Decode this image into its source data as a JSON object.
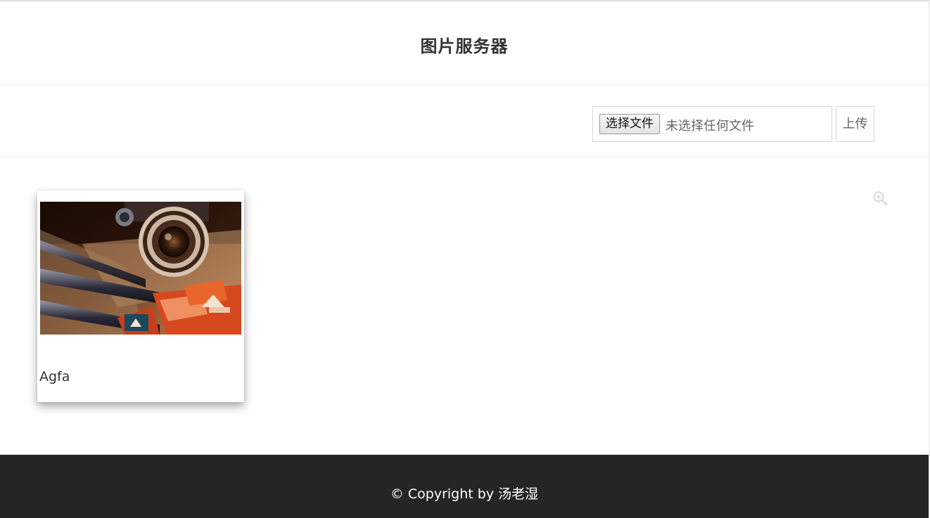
{
  "header": {
    "title": "图片服务器"
  },
  "upload": {
    "choose_file_label": "选择文件",
    "no_file_text": "未选择任何文件",
    "upload_label": "上传"
  },
  "gallery": {
    "zoom_icon": "zoom-in-icon",
    "items": [
      {
        "caption": "Agfa",
        "image": "vintage-camera-photo"
      }
    ]
  },
  "footer": {
    "copyright": "© Copyright by 汤老湿"
  },
  "colors": {
    "footer_bg": "#252525",
    "border": "#d6d6d6",
    "divider": "#ececec"
  }
}
